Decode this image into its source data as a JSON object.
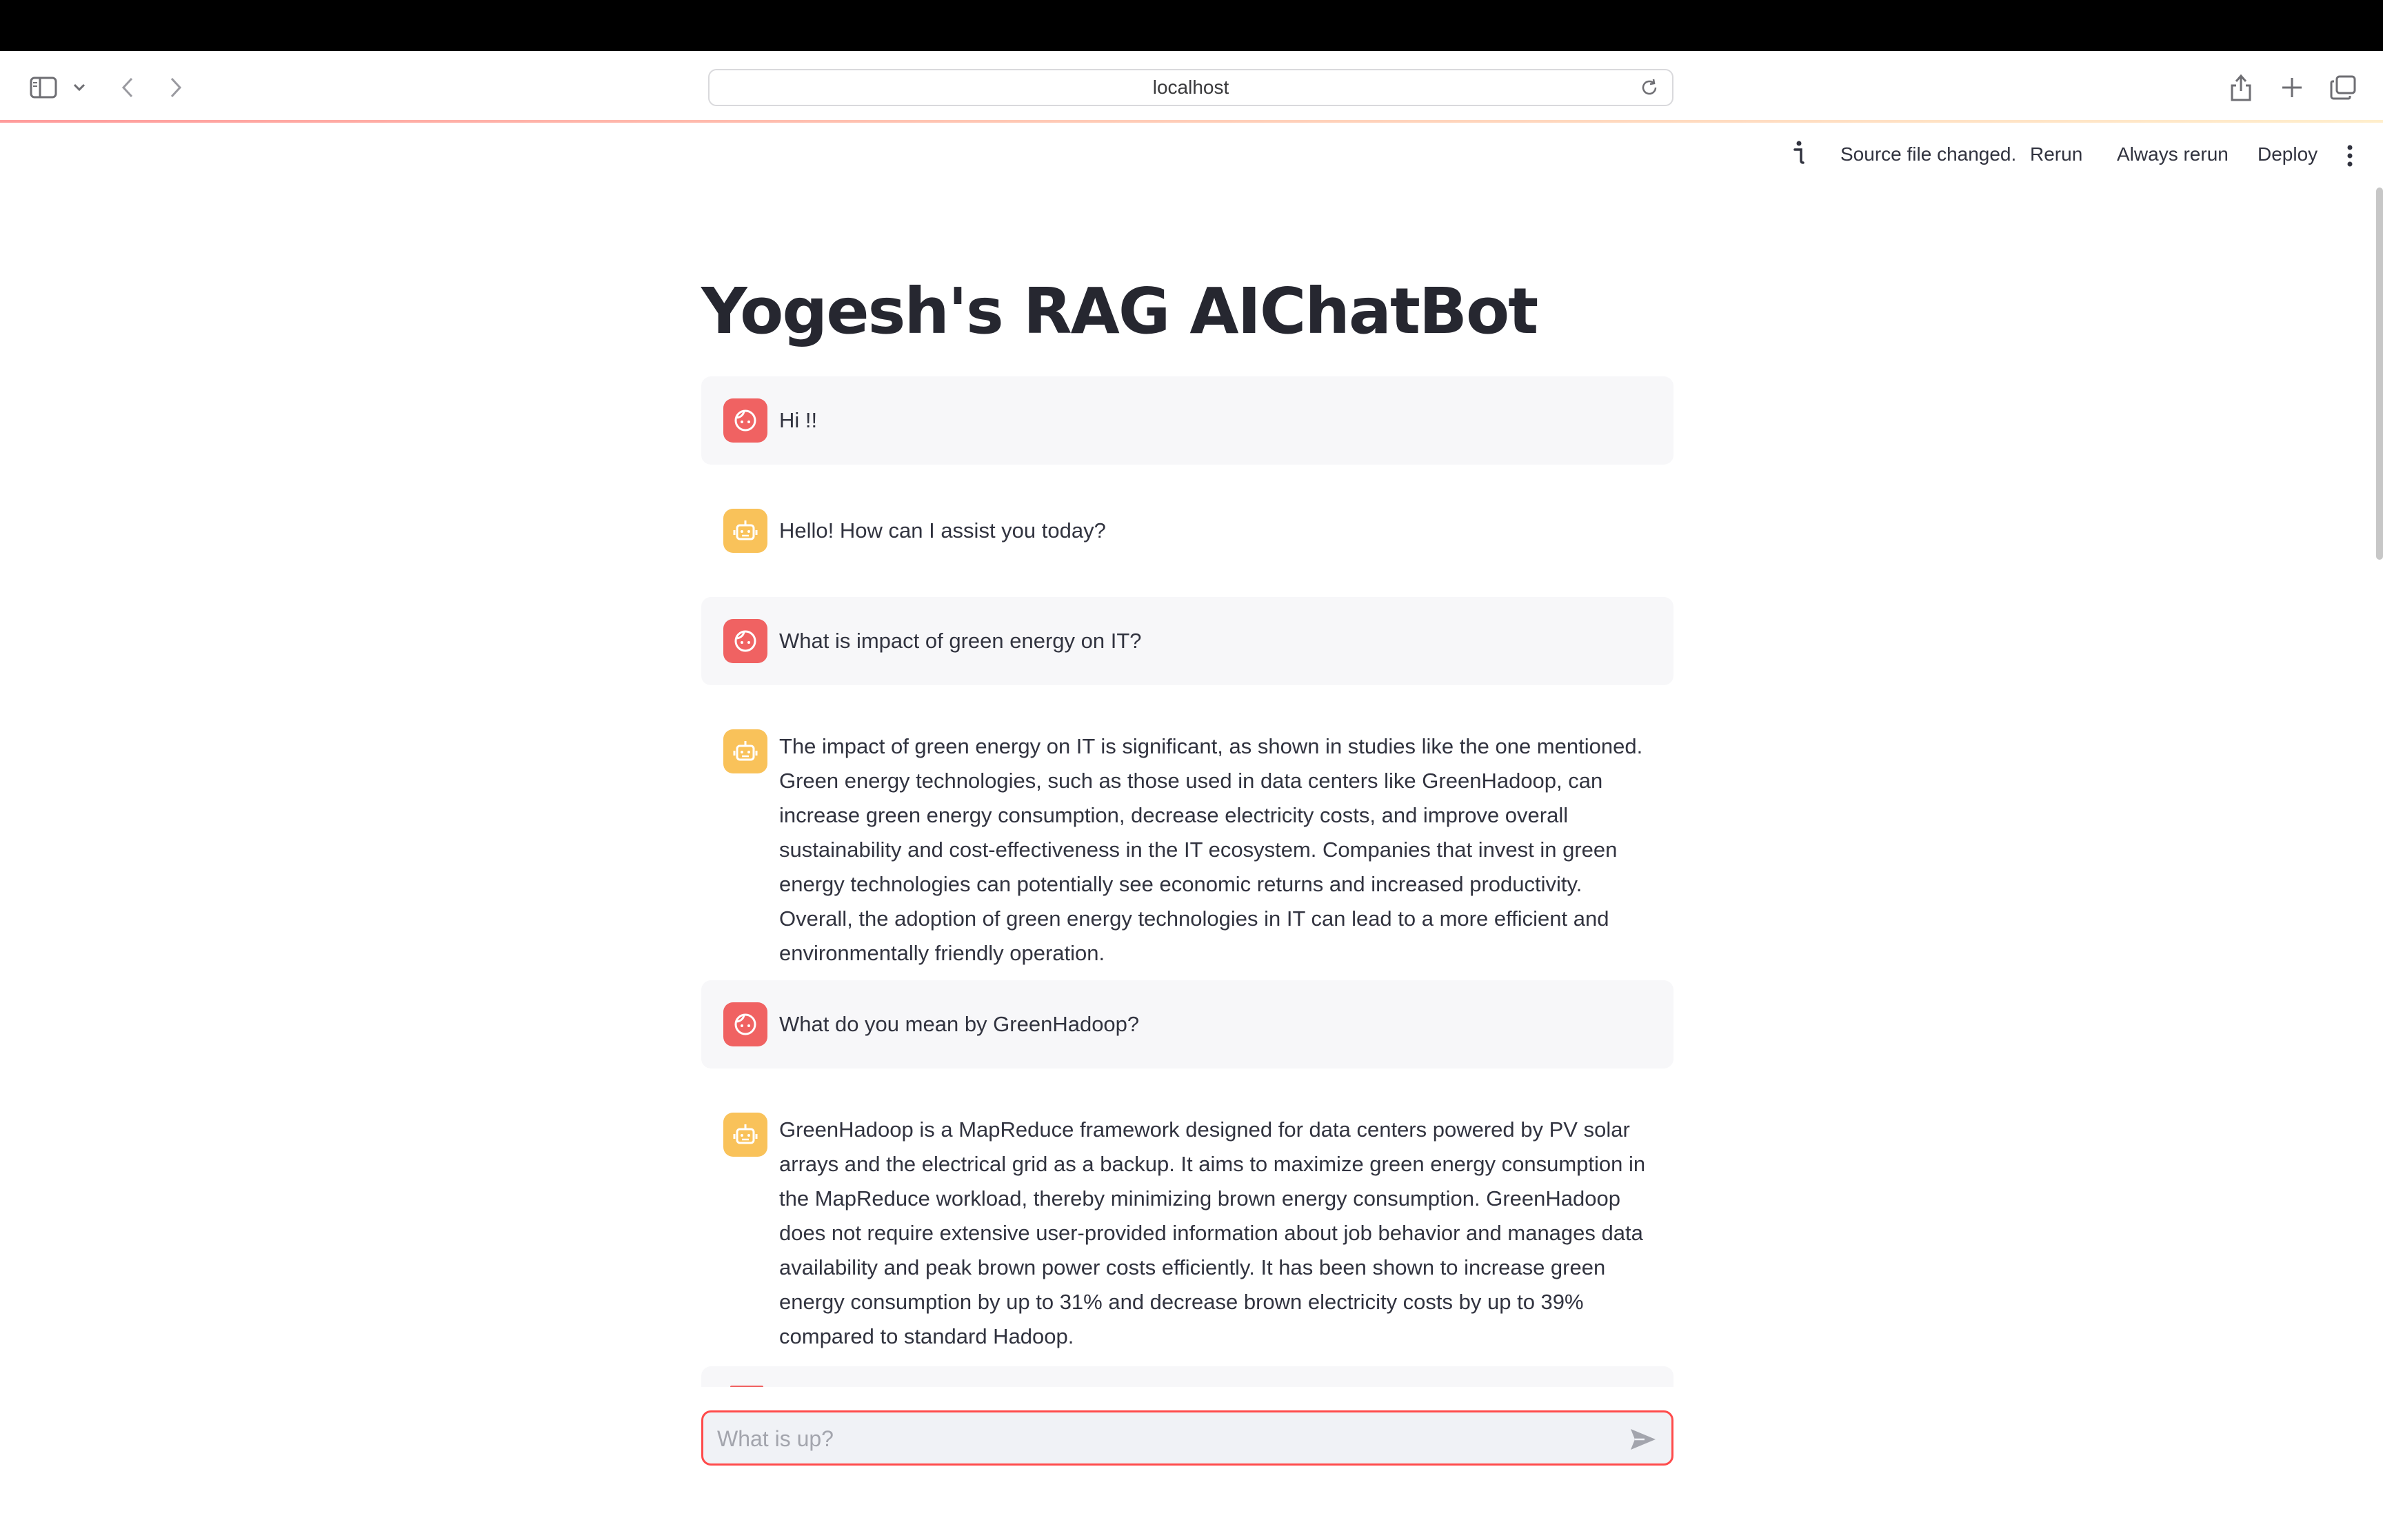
{
  "browser": {
    "url": "localhost"
  },
  "header": {
    "status_text": "Source file changed.",
    "rerun_label": "Rerun",
    "always_rerun_label": "Always rerun",
    "deploy_label": "Deploy"
  },
  "page": {
    "title": "Yogesh's RAG AIChatBot"
  },
  "messages": [
    {
      "role": "user",
      "text": "Hi !!"
    },
    {
      "role": "assistant",
      "text": "Hello! How can I assist you today?"
    },
    {
      "role": "user",
      "text": "What is impact of green energy on IT?"
    },
    {
      "role": "assistant",
      "text": "The impact of green energy on IT is significant, as shown in studies like the one mentioned. Green energy technologies, such as those used in data centers like GreenHadoop, can increase green energy consumption, decrease electricity costs, and improve overall sustainability and cost-effectiveness in the IT ecosystem. Companies that invest in green energy technologies can potentially see economic returns and increased productivity. Overall, the adoption of green energy technologies in IT can lead to a more efficient and environmentally friendly operation."
    },
    {
      "role": "user",
      "text": "What do you mean by GreenHadoop?"
    },
    {
      "role": "assistant",
      "text": "GreenHadoop is a MapReduce framework designed for data centers powered by PV solar arrays and the electrical grid as a backup. It aims to maximize green energy consumption in the MapReduce workload, thereby minimizing brown energy consumption. GreenHadoop does not require extensive user-provided information about job behavior and manages data availability and peak brown power costs efficiently. It has been shown to increase green energy consumption by up to 31% and decrease brown electricity costs by up to 39% compared to standard Hadoop."
    }
  ],
  "chat_input": {
    "placeholder": "What is up?"
  },
  "colors": {
    "user_avatar": "#f06262",
    "bot_avatar": "#f9c25a",
    "accent": "#ff4b4b"
  },
  "icons": {
    "user_avatar": "face-icon",
    "bot_avatar": "robot-icon",
    "send": "send-icon"
  }
}
